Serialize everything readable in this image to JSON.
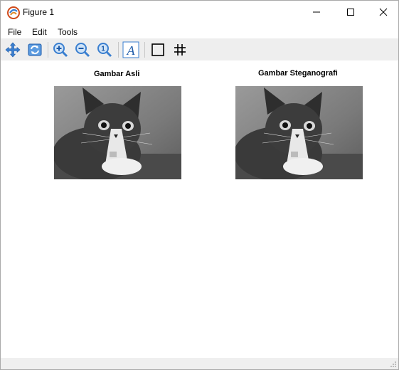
{
  "window": {
    "title": "Figure 1"
  },
  "menu": {
    "items": [
      "File",
      "Edit",
      "Tools"
    ]
  },
  "toolbar": {
    "buttons": [
      "pan-icon",
      "rotate-icon",
      "zoom-in-icon",
      "zoom-out-icon",
      "zoom-reset-icon",
      "insert-text-icon",
      "box-icon",
      "grid-icon"
    ]
  },
  "figure": {
    "axes": [
      {
        "title": "Gambar Asli",
        "image": "grayscale kitten photo"
      },
      {
        "title": "Gambar Steganografi",
        "image": "grayscale kitten photo"
      }
    ]
  },
  "colors": {
    "toolbar_bg": "#eeeeee",
    "statusbar_bg": "#efefef",
    "icon_blue": "#3a7fd0"
  }
}
